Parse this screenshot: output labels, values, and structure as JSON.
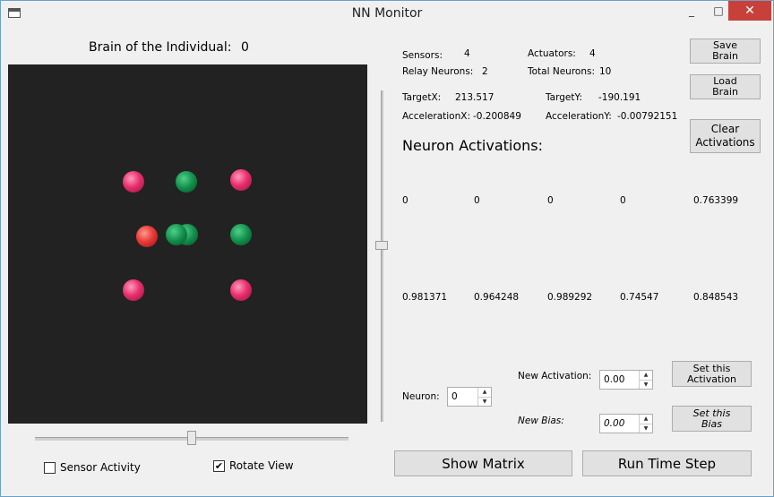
{
  "window": {
    "title": "NN Monitor",
    "minimize": "_",
    "maximize": "□",
    "close": "✕"
  },
  "brain": {
    "label": "Brain of the Individual:",
    "value": "0"
  },
  "stats": {
    "sensors_label": "Sensors:",
    "sensors_value": "4",
    "actuators_label": "Actuators:",
    "actuators_value": "4",
    "relay_label": "Relay Neurons:",
    "relay_value": "2",
    "total_label": "Total Neurons:",
    "total_value": "10",
    "targetx_label": "TargetX:",
    "targetx_value": "213.517",
    "targety_label": "TargetY:",
    "targety_value": "-190.191",
    "accx_label": "AccelerationX:",
    "accx_value": "-0.200849",
    "accy_label": "AccelerationY:",
    "accy_value": "-0.00792151"
  },
  "buttons": {
    "save_brain": "Save\nBrain",
    "load_brain": "Load\nBrain",
    "clear_activations": "Clear\nActivations",
    "set_activation": "Set this\nActivation",
    "set_bias": "Set this\nBias",
    "show_matrix": "Show Matrix",
    "run_time_step": "Run Time Step"
  },
  "activations": {
    "heading": "Neuron Activations:",
    "row1": [
      "0",
      "0",
      "0",
      "0",
      "0.763399"
    ],
    "row2": [
      "0.981371",
      "0.964248",
      "0.989292",
      "0.74547",
      "0.848543"
    ]
  },
  "controls": {
    "neuron_label": "Neuron:",
    "neuron_value": "0",
    "new_activation_label": "New Activation:",
    "new_activation_value": "0.00",
    "new_bias_label": "New Bias:",
    "new_bias_value": "0.00",
    "sensor_activity_label": "Sensor Activity",
    "sensor_activity_checked": false,
    "rotate_view_label": "Rotate View",
    "rotate_view_checked": true,
    "check_mark": "✔"
  },
  "neurons_view": {
    "neurons": [
      {
        "color": "#e8306e",
        "type": "pink"
      },
      {
        "color": "#128e4a",
        "type": "green"
      },
      {
        "color": "#e8306e",
        "type": "pink"
      },
      {
        "color": "#e83a3a",
        "type": "red"
      },
      {
        "color": "#128e4a",
        "type": "green"
      },
      {
        "color": "#128e4a",
        "type": "green"
      },
      {
        "color": "#128e4a",
        "type": "green"
      },
      {
        "color": "#e8306e",
        "type": "pink"
      },
      {
        "color": "#e8306e",
        "type": "pink"
      }
    ]
  },
  "colors": {
    "accent": "#1e8fc7",
    "close": "#c7413a",
    "view_bg": "#222222"
  }
}
